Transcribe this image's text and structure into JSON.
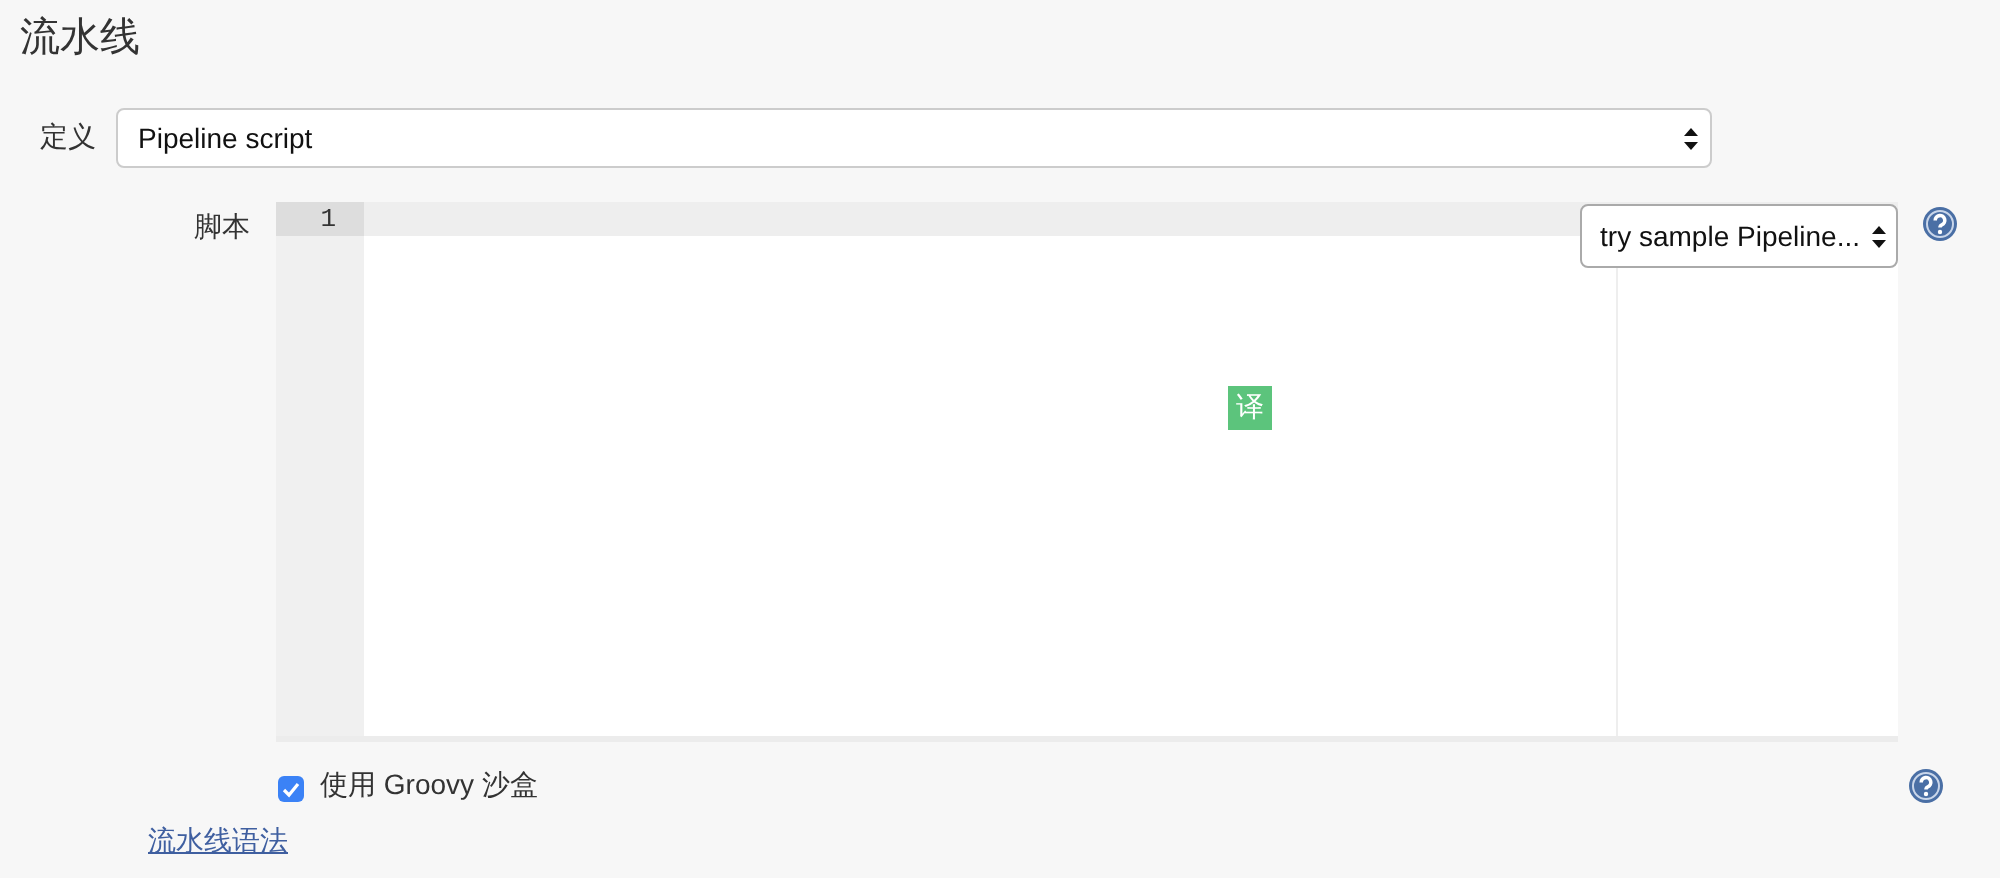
{
  "section": {
    "title": "流水线"
  },
  "definition": {
    "label": "定义",
    "value": "Pipeline script"
  },
  "script": {
    "label": "脚本",
    "line_numbers": [
      "1"
    ],
    "sample_select": "try sample Pipeline...",
    "translate_badge": "译"
  },
  "sandbox": {
    "label": "使用 Groovy 沙盒",
    "checked": true
  },
  "syntax_link": "流水线语法"
}
